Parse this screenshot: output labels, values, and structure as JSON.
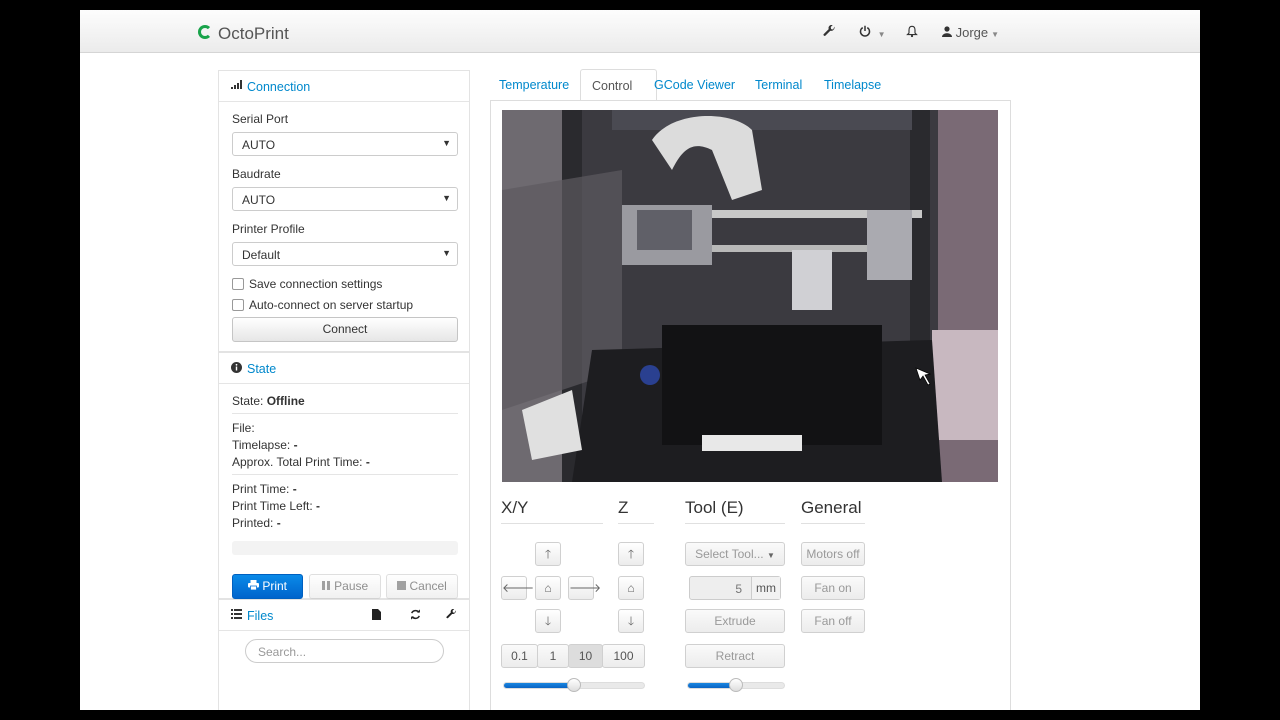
{
  "navbar": {
    "brand": "OctoPrint",
    "user": "Jorge",
    "wrench_icon": "wrench-icon",
    "power_icon": "power-icon",
    "bell_icon": "bell-icon",
    "user_icon": "user-icon"
  },
  "connection": {
    "title": "Connection",
    "serial_port_label": "Serial Port",
    "serial_port_value": "AUTO",
    "baudrate_label": "Baudrate",
    "baudrate_value": "AUTO",
    "profile_label": "Printer Profile",
    "profile_value": "Default",
    "save_settings_label": "Save connection settings",
    "autoconnect_label": "Auto-connect on server startup",
    "connect_button": "Connect"
  },
  "state": {
    "title": "State",
    "state_label": "State:",
    "state_value": "Offline",
    "file_label": "File:",
    "file_value": "",
    "timelapse_label": "Timelapse:",
    "timelapse_value": "-",
    "approx_label": "Approx. Total Print Time:",
    "approx_value": "-",
    "print_time_label": "Print Time:",
    "print_time_value": "-",
    "time_left_label": "Print Time Left:",
    "time_left_value": "-",
    "printed_label": "Printed:",
    "printed_value": "-",
    "progress": 0,
    "print_button": "Print",
    "pause_button": "Pause",
    "cancel_button": "Cancel"
  },
  "files": {
    "title": "Files",
    "search_placeholder": "Search..."
  },
  "tabs": [
    "Temperature",
    "Control",
    "GCode Viewer",
    "Terminal",
    "Timelapse"
  ],
  "active_tab": "Control",
  "control": {
    "xy_title": "X/Y",
    "z_title": "Z",
    "tool_title": "Tool (E)",
    "general_title": "General",
    "step_values": [
      "0.1",
      "1",
      "10",
      "100"
    ],
    "selected_step": "10",
    "select_tool": "Select Tool...",
    "extrude_amount": "5",
    "extrude_unit": "mm",
    "extrude_button": "Extrude",
    "retract_button": "Retract",
    "motors_off": "Motors off",
    "fan_on": "Fan on",
    "fan_off": "Fan off",
    "feedrate_level": 0.5,
    "flowrate_level": 0.5
  },
  "colors": {
    "link": "#0088cc",
    "primary": "#0a74da",
    "brand_green": "#18a34a"
  }
}
